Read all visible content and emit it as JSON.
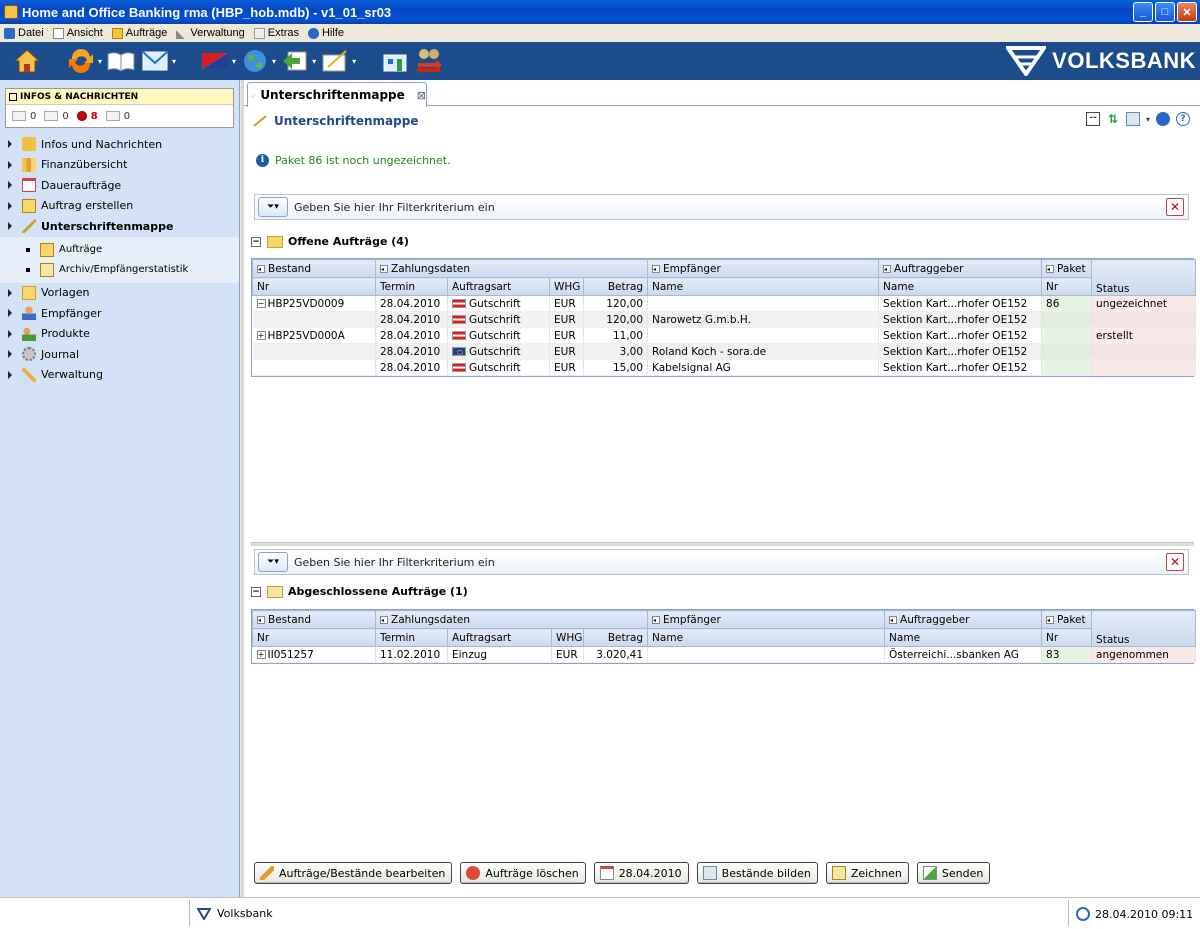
{
  "window": {
    "title": "Home and Office Banking rma (HBP_hob.mdb) - v1_01_sr03",
    "buttons": {
      "minimize": "_",
      "maximize": "□",
      "close": "✕"
    }
  },
  "menu": [
    {
      "label": "Datei",
      "icon": "app-icon"
    },
    {
      "label": "Ansicht",
      "icon": "document-icon"
    },
    {
      "label": "Aufträge",
      "icon": "envelope-icon"
    },
    {
      "label": "Verwaltung",
      "icon": "wrench-icon"
    },
    {
      "label": "Extras",
      "icon": "notepad-icon"
    },
    {
      "label": "Hilfe",
      "icon": "help-icon"
    }
  ],
  "toolbar": {
    "brand": "VOLKSBANK",
    "brand_color": "#1d4c8d"
  },
  "sidebar": {
    "infos_box": {
      "title": "INFOS & NACHRICHTEN",
      "counts": [
        "0",
        "0",
        "8",
        "0"
      ]
    },
    "items": [
      {
        "label": "Infos und Nachrichten",
        "icon": "megaphone-icon"
      },
      {
        "label": "Finanzübersicht",
        "icon": "chart-icon"
      },
      {
        "label": "Daueraufträge",
        "icon": "calendar-icon"
      },
      {
        "label": "Auftrag erstellen",
        "icon": "envelope-icon"
      },
      {
        "label": "Unterschriftenmappe",
        "icon": "pen-icon",
        "active": true
      }
    ],
    "subitems": [
      {
        "label": "Aufträge",
        "icon": "envelope-icon"
      },
      {
        "label": "Archiv/Empfängerstatistik",
        "icon": "archive-icon"
      }
    ],
    "items_after": [
      {
        "label": "Vorlagen",
        "icon": "folder-icon"
      },
      {
        "label": "Empfänger",
        "icon": "person-icon"
      },
      {
        "label": "Produkte",
        "icon": "people-icon"
      },
      {
        "label": "Journal",
        "icon": "gear-icon"
      },
      {
        "label": "Verwaltung",
        "icon": "wrench-icon"
      }
    ]
  },
  "main": {
    "tab_label": "Unterschriftenmappe",
    "page_title": "Unterschriftenmappe",
    "info_message": "Paket 86 ist noch ungezeichnet.",
    "filter_placeholder": "Geben Sie hier Ihr Filterkriterium ein",
    "open_section": {
      "title": "Offene Aufträge (4)",
      "group_headers": [
        "Bestand",
        "Zahlungsdaten",
        "Empfänger",
        "Auftraggeber",
        "Paket"
      ],
      "columns": [
        "Nr",
        "Termin",
        "Auftragsart",
        "WHG",
        "Betrag",
        "Name",
        "Name",
        "Nr",
        "Status"
      ],
      "rows": [
        {
          "expand": "−",
          "nr": "HBP25VD0009",
          "termin": "28.04.2010",
          "flag": "at",
          "art": "Gutschrift",
          "whg": "EUR",
          "betrag": "120,00",
          "empf": "",
          "auftr": "Sektion Kart...rhofer OE152",
          "paket": "86",
          "status": "ungezeichnet"
        },
        {
          "expand": "",
          "nr": "",
          "termin": "28.04.2010",
          "flag": "at",
          "art": "Gutschrift",
          "whg": "EUR",
          "betrag": "120,00",
          "empf": "Narowetz G.m.b.H.",
          "auftr": "Sektion Kart...rhofer OE152",
          "paket": "",
          "status": ""
        },
        {
          "expand": "+",
          "nr": "HBP25VD000A",
          "termin": "28.04.2010",
          "flag": "at",
          "art": "Gutschrift",
          "whg": "EUR",
          "betrag": "11,00",
          "empf": "",
          "auftr": "Sektion Kart...rhofer OE152",
          "paket": "",
          "status": "erstellt"
        },
        {
          "expand": "",
          "nr": "",
          "termin": "28.04.2010",
          "flag": "eu",
          "art": "Gutschrift",
          "whg": "EUR",
          "betrag": "3,00",
          "empf": "Roland Koch - sora.de",
          "auftr": "Sektion Kart...rhofer OE152",
          "paket": "",
          "status": ""
        },
        {
          "expand": "",
          "nr": "",
          "termin": "28.04.2010",
          "flag": "at",
          "art": "Gutschrift",
          "whg": "EUR",
          "betrag": "15,00",
          "empf": "Kabelsignal AG",
          "auftr": "Sektion Kart...rhofer OE152",
          "paket": "",
          "status": ""
        }
      ]
    },
    "closed_section": {
      "title": "Abgeschlossene Aufträge (1)",
      "group_headers": [
        "Bestand",
        "Zahlungsdaten",
        "Empfänger",
        "Auftraggeber",
        "Paket"
      ],
      "columns": [
        "Nr",
        "Termin",
        "Auftragsart",
        "WHG",
        "Betrag",
        "Name",
        "Name",
        "Nr",
        "Status"
      ],
      "rows": [
        {
          "expand": "+",
          "nr": "II051257",
          "termin": "11.02.2010",
          "flag": "",
          "art": "Einzug",
          "whg": "EUR",
          "betrag": "3.020,41",
          "empf": "",
          "auftr": "Österreichi...sbanken AG",
          "paket": "83",
          "status": "angenommen"
        }
      ]
    },
    "actions": [
      {
        "label": "Aufträge/Bestände bearbeiten",
        "icon": "pencil-icon"
      },
      {
        "label": "Aufträge löschen",
        "icon": "delete-icon"
      },
      {
        "label": "28.04.2010",
        "icon": "calendar-icon"
      },
      {
        "label": "Bestände bilden",
        "icon": "stack-icon"
      },
      {
        "label": "Zeichnen",
        "icon": "sign-icon"
      },
      {
        "label": "Senden",
        "icon": "send-icon"
      }
    ]
  },
  "statusbar": {
    "bank": "Volksbank",
    "datetime": "28.04.2010 09:11"
  }
}
